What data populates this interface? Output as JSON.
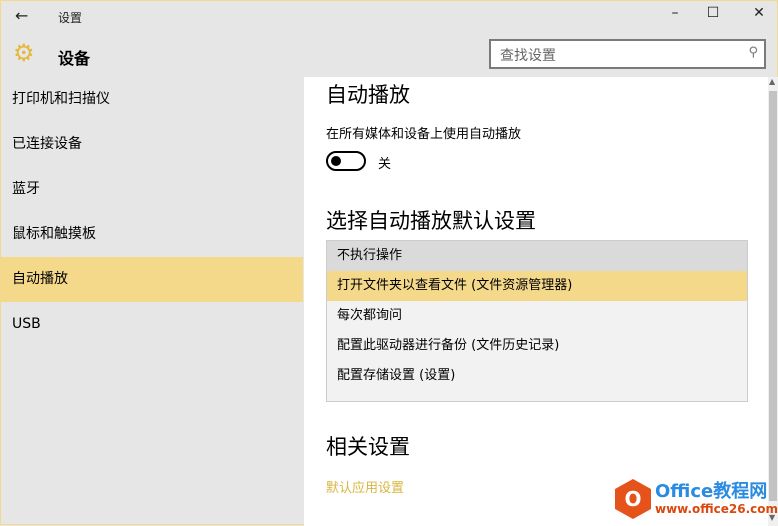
{
  "window": {
    "title": "设置",
    "back": "←",
    "minimize": "–",
    "maximize": "☐",
    "close": "✕"
  },
  "header": {
    "title": "设备",
    "search_placeholder": "查找设置"
  },
  "sidebar": {
    "items": [
      {
        "label": "打印机和扫描仪"
      },
      {
        "label": "已连接设备"
      },
      {
        "label": "蓝牙"
      },
      {
        "label": "鼠标和触摸板"
      },
      {
        "label": "自动播放"
      },
      {
        "label": "USB"
      }
    ]
  },
  "content": {
    "autoplay_title": "自动播放",
    "autoplay_label": "在所有媒体和设备上使用自动播放",
    "toggle_state": "关",
    "toggle_on": false,
    "defaults_title": "选择自动播放默认设置",
    "options": [
      {
        "label": "不执行操作"
      },
      {
        "label": "打开文件夹以查看文件 (文件资源管理器)"
      },
      {
        "label": "每次都询问"
      },
      {
        "label": "配置此驱动器进行备份 (文件历史记录)"
      },
      {
        "label": "配置存储设置 (设置)"
      }
    ],
    "related_title": "相关设置",
    "related_link": "默认应用设置"
  },
  "watermark": {
    "line1": "Office教程网",
    "line2": "www.office26.com"
  },
  "colors": {
    "accent": "#f5d98b",
    "link": "#d8b640"
  }
}
